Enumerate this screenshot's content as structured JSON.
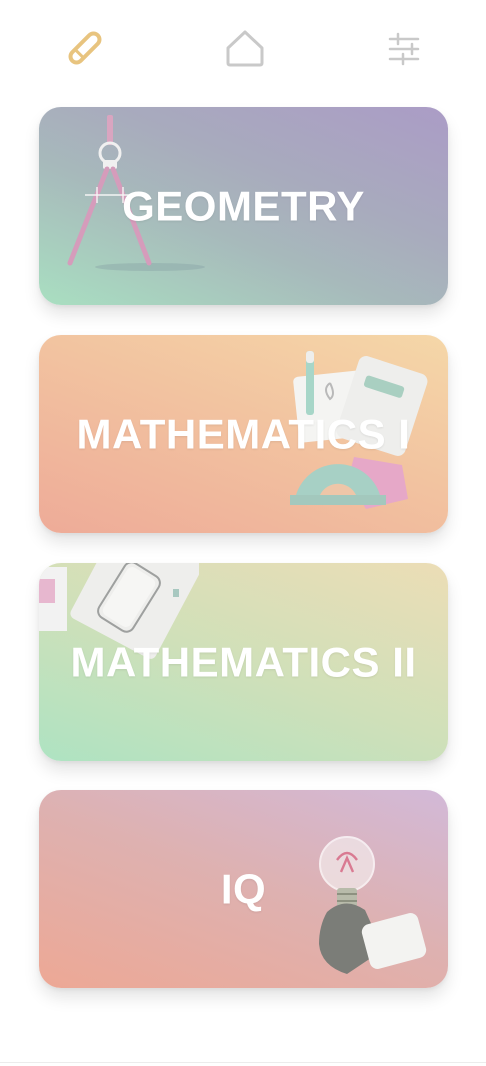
{
  "nav": {
    "icons": [
      "pencil-icon",
      "home-icon",
      "filter-sliders-icon"
    ]
  },
  "colors": {
    "pencil_active": "#e8c47f",
    "nav_inactive": "#c9c9c9",
    "card_text": "#ffffff"
  },
  "cards": [
    {
      "title": "GEOMETRY",
      "illustration": "drawing-compass"
    },
    {
      "title": "MATHEMATICS I",
      "illustration": "calculator-protractor"
    },
    {
      "title": "MATHEMATICS II",
      "illustration": "phone-notebook"
    },
    {
      "title": "IQ",
      "illustration": "hand-holding-lightbulb"
    }
  ]
}
